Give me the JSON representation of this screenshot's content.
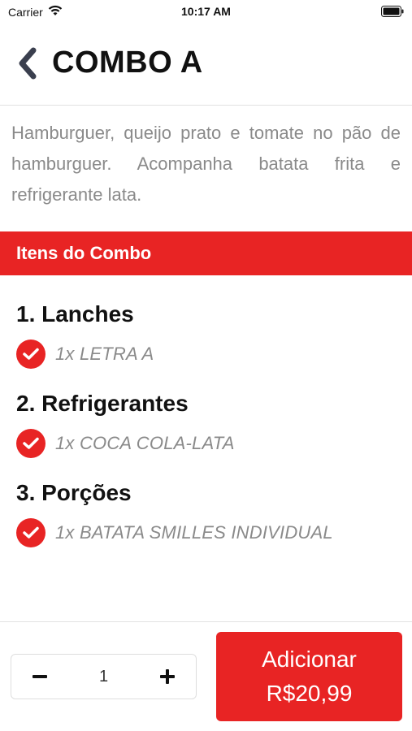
{
  "status_bar": {
    "carrier": "Carrier",
    "time": "10:17 AM"
  },
  "header": {
    "title": "COMBO A"
  },
  "description": "Hamburguer, queijo prato e tomate no pão de hamburguer. Acompanha batata frita e refrigerante lata.",
  "section": {
    "title": "Itens do Combo"
  },
  "groups": [
    {
      "title": "1. Lanches",
      "items": [
        "1x LETRA A"
      ]
    },
    {
      "title": "2. Refrigerantes",
      "items": [
        "1x COCA COLA-LATA"
      ]
    },
    {
      "title": "3. Porções",
      "items": [
        "1x BATATA SMILLES INDIVIDUAL"
      ]
    }
  ],
  "footer": {
    "quantity": "1",
    "minus_label": "−",
    "plus_label": "+",
    "add_label": "Adicionar",
    "price": "R$20,99"
  },
  "colors": {
    "accent": "#e82424",
    "muted_text": "#8a8a8a"
  }
}
